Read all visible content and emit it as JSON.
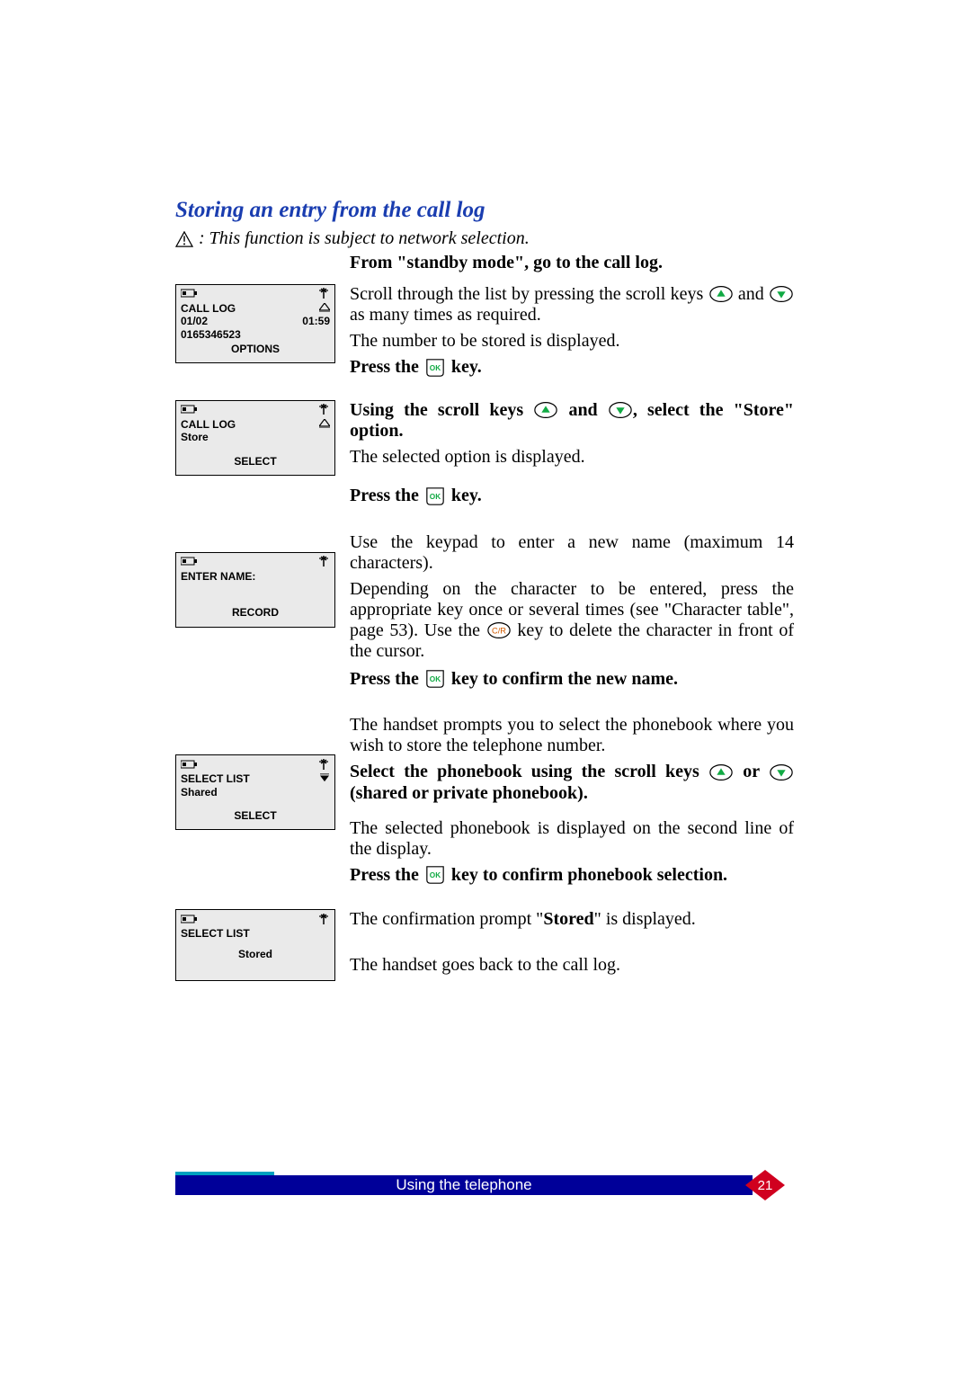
{
  "section_title": "Storing an entry from the call log",
  "network_note": ": This function is subject to network selection.",
  "intro_bold": "From \"standby mode\", go to the call log.",
  "step1": {
    "lcd": {
      "line1": "CALL LOG",
      "line2_left": "01/02",
      "line2_right": "01:59",
      "line3": "0165346523",
      "softkey": "OPTIONS"
    },
    "p1a": "Scroll through the list by pressing the scroll keys ",
    "p1b": " and ",
    "p1c": " as many times as required.",
    "p2": "The number to be stored is displayed.",
    "p3a": "Press the ",
    "p3b": " key."
  },
  "step2": {
    "lcd": {
      "line1": "CALL LOG",
      "line2": "Store",
      "softkey": "SELECT"
    },
    "p1a": "Using the scroll keys ",
    "p1b": " and ",
    "p1c": ", select the \"Store\" option.",
    "p2": "The selected option is displayed.",
    "p3a": "Press the ",
    "p3b": " key."
  },
  "step3": {
    "lcd": {
      "line1": "ENTER NAME:",
      "softkey": "RECORD"
    },
    "p1": "Use the keypad to enter a new name (maximum 14 characters).",
    "p2a": "Depending on the character to be entered, press the appropriate key once or several times (see \"Character table\", page 53). Use the ",
    "p2b": " key to delete the character in front of the cursor.",
    "p3a": "Press the ",
    "p3b": " key to confirm the new name."
  },
  "step4": {
    "lcd": {
      "line1": "SELECT LIST",
      "line2": "Shared",
      "softkey": "SELECT"
    },
    "pre": "The handset prompts you to select the phonebook where you wish to store the telephone number.",
    "p1a": "Select the phonebook using the scroll keys ",
    "p1b": " or ",
    "p1c": " (shared or private phonebook).",
    "p2": "The selected phonebook is displayed on the second line of the display.",
    "p3a": "Press the ",
    "p3b": " key to confirm phonebook selection."
  },
  "step5": {
    "lcd": {
      "line1": "SELECT LIST",
      "mid": "Stored"
    },
    "p1a": "The confirmation prompt \"",
    "p1b": "Stored",
    "p1c": "\" is displayed.",
    "p2": "The handset goes back to the call log."
  },
  "footer": {
    "text": "Using the telephone",
    "page": "21"
  }
}
